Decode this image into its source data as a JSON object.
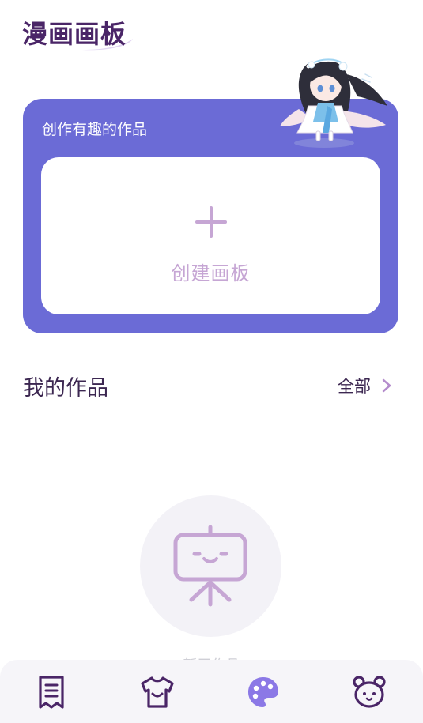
{
  "app": {
    "title": "漫画画板"
  },
  "create_card": {
    "title": "创作有趣的作品",
    "button_label": "创建画板"
  },
  "my_works": {
    "title": "我的作品",
    "see_all_label": "全部"
  },
  "empty_state": {
    "text": "暂无作品"
  },
  "tab_bar": {
    "items": [
      {
        "icon": "receipt-icon",
        "active": false
      },
      {
        "icon": "tshirt-icon",
        "active": false
      },
      {
        "icon": "palette-icon",
        "active": true
      },
      {
        "icon": "bear-icon",
        "active": false
      }
    ]
  },
  "colors": {
    "primary": "#6b6bd6",
    "title": "#4a2567",
    "accent_light": "#c6a6d4",
    "text_dark": "#3c2751",
    "tab_bg": "#f6f5f9"
  }
}
